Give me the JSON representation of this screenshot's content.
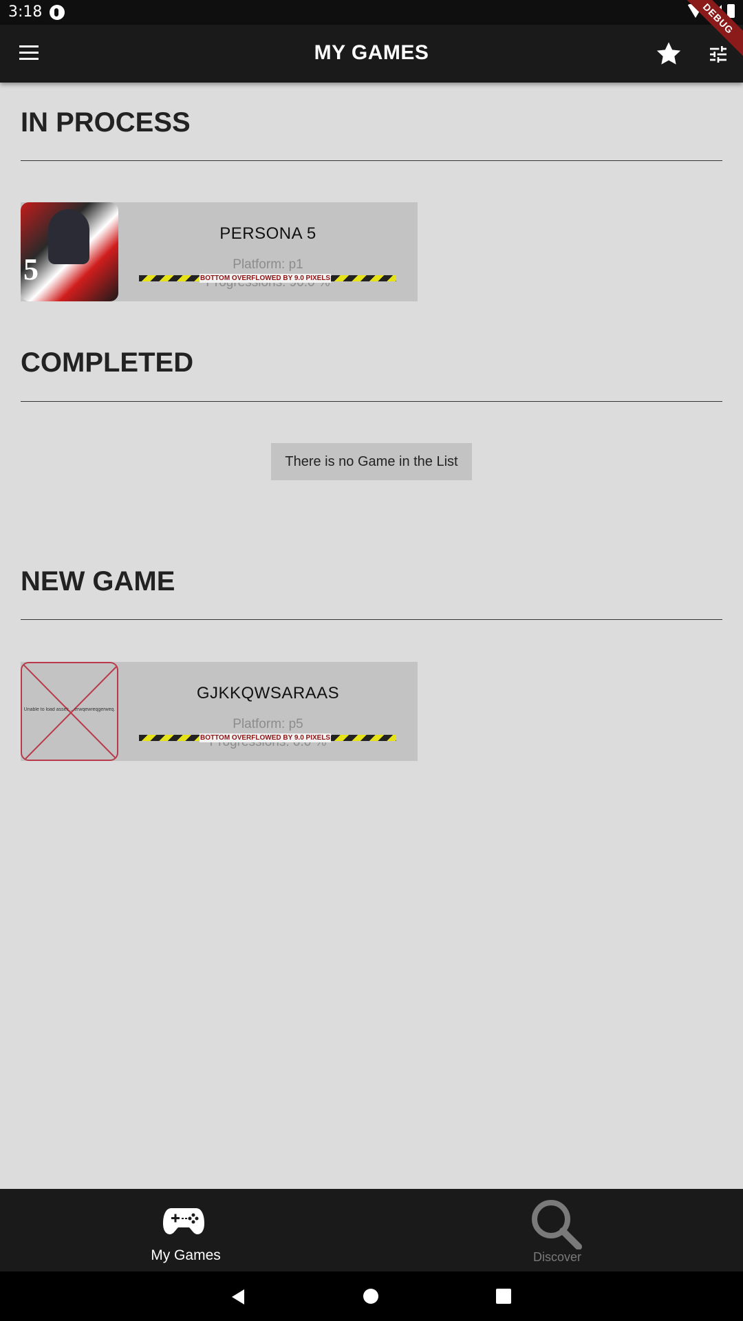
{
  "status_bar": {
    "time": "3:18",
    "debug_label": "DEBUG"
  },
  "app_bar": {
    "title": "MY GAMES"
  },
  "sections": {
    "in_process": {
      "title": "IN  PROCESS",
      "games": [
        {
          "name": "PERSONA  5",
          "platform": "Platform:  p1",
          "progress": "Progressions:  90.0  %",
          "overflow": "BOTTOM OVERFLOWED BY 9.0 PIXELS"
        }
      ]
    },
    "completed": {
      "title": "COMPLETED",
      "empty_message": "There is no Game in the List"
    },
    "new_game": {
      "title": "NEW  GAME",
      "games": [
        {
          "name": "GJKKQWSARAAS",
          "platform": "Platform:  p5",
          "progress": "Progressions:  0.0  %",
          "overflow": "BOTTOM OVERFLOWED BY 9.0 PIXELS",
          "image_error": "Unable to load asset: ...erwqewreqgerweq."
        }
      ]
    }
  },
  "bottom_nav": {
    "items": [
      {
        "label": "My Games",
        "icon": "gamepad-icon",
        "active": true
      },
      {
        "label": "Discover",
        "icon": "search-icon",
        "active": false
      }
    ]
  },
  "colors": {
    "app_bar": "#1a1a1a",
    "background": "#dcdcdc",
    "card": "#c3c3c3",
    "debug": "#8b1b1b",
    "inactive_nav": "#7a7a7a"
  }
}
